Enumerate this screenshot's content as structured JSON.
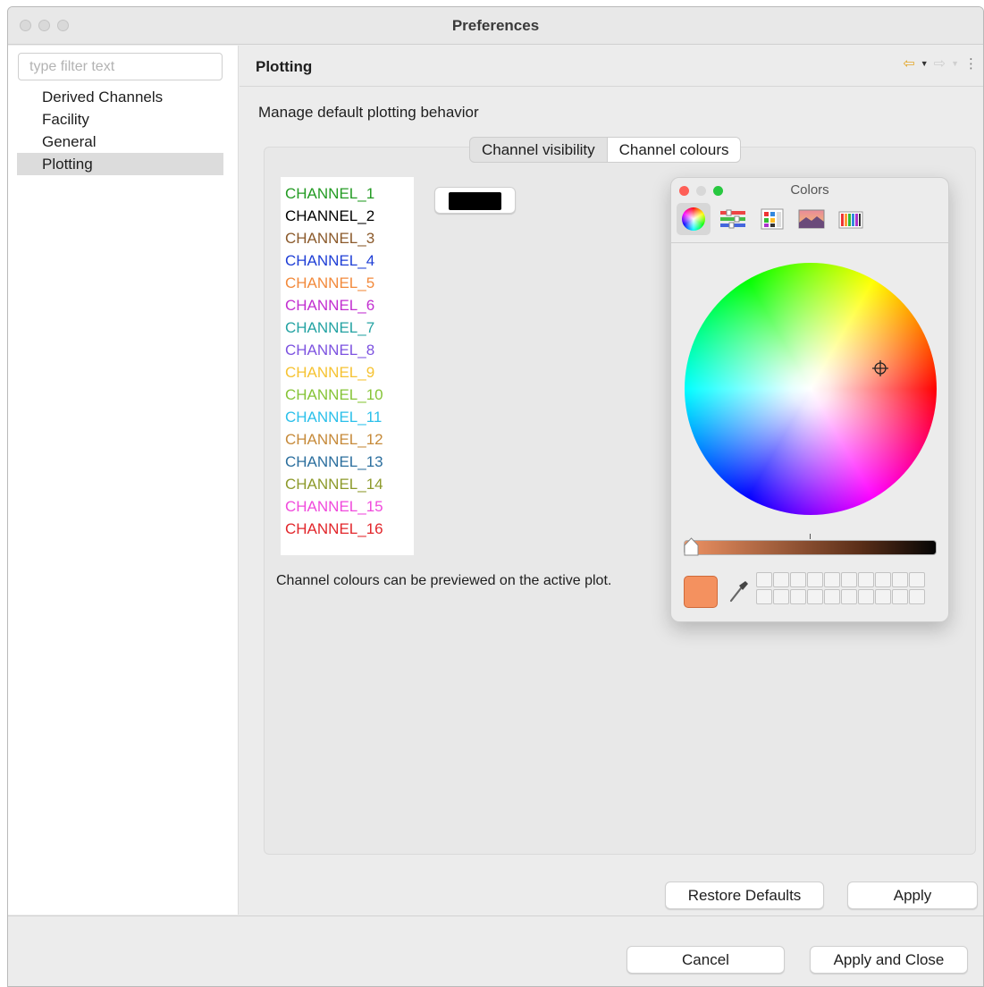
{
  "window": {
    "title": "Preferences"
  },
  "sidebar": {
    "filter_placeholder": "type filter text",
    "items": [
      {
        "label": "Derived Channels"
      },
      {
        "label": "Facility"
      },
      {
        "label": "General"
      },
      {
        "label": "Plotting",
        "selected": true
      }
    ]
  },
  "page": {
    "title": "Plotting",
    "description": "Manage default plotting behavior",
    "header_icons": [
      "back-arrow-icon",
      "forward-arrow-icon",
      "menu-icon"
    ],
    "tabs": [
      {
        "label": "Channel visibility"
      },
      {
        "label": "Channel colours",
        "active": true
      }
    ],
    "channels": [
      {
        "label": "CHANNEL_1",
        "color": "#239b23"
      },
      {
        "label": "CHANNEL_2",
        "color": "#000000"
      },
      {
        "label": "CHANNEL_3",
        "color": "#8b5a2b"
      },
      {
        "label": "CHANNEL_4",
        "color": "#1f3fd6"
      },
      {
        "label": "CHANNEL_5",
        "color": "#f28a3c"
      },
      {
        "label": "CHANNEL_6",
        "color": "#c22fd0"
      },
      {
        "label": "CHANNEL_7",
        "color": "#24a3a3"
      },
      {
        "label": "CHANNEL_8",
        "color": "#7d53e0"
      },
      {
        "label": "CHANNEL_9",
        "color": "#f6c333"
      },
      {
        "label": "CHANNEL_10",
        "color": "#86c437"
      },
      {
        "label": "CHANNEL_11",
        "color": "#2cc0ea"
      },
      {
        "label": "CHANNEL_12",
        "color": "#c68a3a"
      },
      {
        "label": "CHANNEL_13",
        "color": "#2c6f9e"
      },
      {
        "label": "CHANNEL_14",
        "color": "#8d9a2b"
      },
      {
        "label": "CHANNEL_15",
        "color": "#f04adc"
      },
      {
        "label": "CHANNEL_16",
        "color": "#e2262b"
      }
    ],
    "selected_swatch_color": "#000000",
    "note": "Channel colours can be previewed on the active plot."
  },
  "colors_panel": {
    "title": "Colors",
    "modes": [
      "color-wheel-icon",
      "sliders-icon",
      "palettes-icon",
      "image-palette-icon",
      "pencils-icon"
    ],
    "current_color": "#f4915f",
    "brightness": 1.0,
    "swatch_slots": 20
  },
  "buttons": {
    "restore_defaults": "Restore Defaults",
    "apply": "Apply",
    "cancel": "Cancel",
    "apply_and_close": "Apply and Close"
  }
}
